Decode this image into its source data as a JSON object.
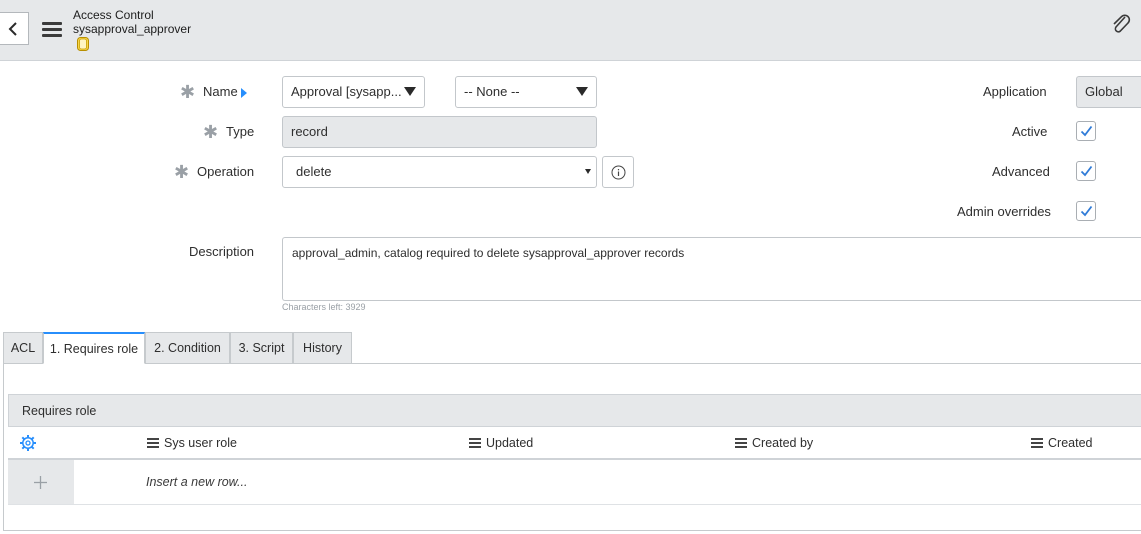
{
  "header": {
    "title": "Access Control",
    "record_name": "sysapproval_approver"
  },
  "form": {
    "name": {
      "label": "Name",
      "table_value": "Approval [sysapp...",
      "field_value": "-- None --"
    },
    "type": {
      "label": "Type",
      "value": "record"
    },
    "operation": {
      "label": "Operation",
      "value": "delete"
    },
    "application": {
      "label": "Application",
      "value": "Global"
    },
    "active": {
      "label": "Active",
      "checked": true
    },
    "advanced": {
      "label": "Advanced",
      "checked": true
    },
    "admin_overrides": {
      "label": "Admin overrides",
      "checked": true
    },
    "description": {
      "label": "Description",
      "value": "approval_admin, catalog required to delete sysapproval_approver records",
      "chars_left": "Characters left: 3929"
    }
  },
  "tabs": [
    {
      "label": "ACL"
    },
    {
      "label": "1. Requires role",
      "active": true
    },
    {
      "label": "2. Condition"
    },
    {
      "label": "3. Script"
    },
    {
      "label": "History"
    }
  ],
  "related_list": {
    "title": "Requires role",
    "columns": [
      "Sys user role",
      "Updated",
      "Created by",
      "Created"
    ],
    "insert_row_text": "Insert a new row..."
  },
  "colors": {
    "accent": "#278efc",
    "checkbox_check": "#2f7bd8",
    "header_bg": "#e6e8ea"
  },
  "icons": [
    "back-icon",
    "menu-icon",
    "database-icon",
    "paperclip-icon",
    "info-icon",
    "gear-icon",
    "add-row-icon"
  ]
}
